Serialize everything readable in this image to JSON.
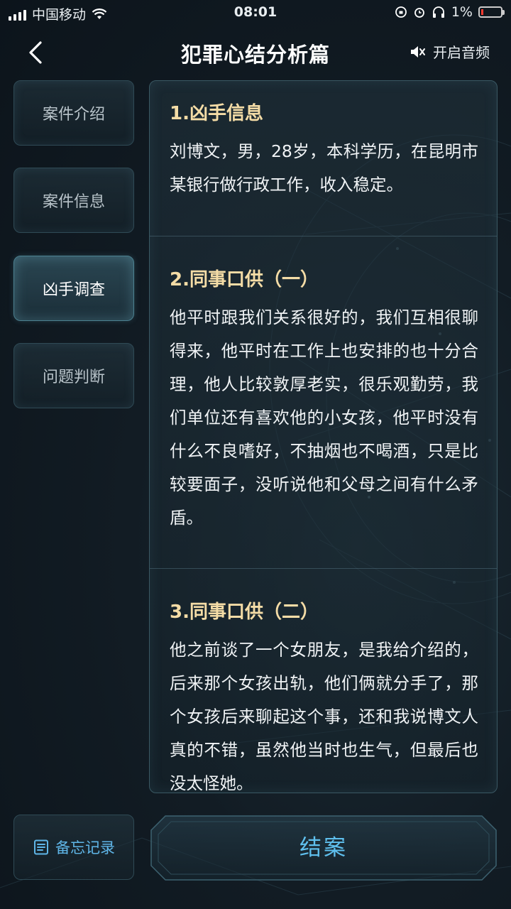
{
  "status_bar": {
    "carrier": "中国移动",
    "time": "08:01",
    "battery": "1%"
  },
  "header": {
    "title": "犯罪心结分析篇",
    "audio_label": "开启音频"
  },
  "sidebar": {
    "items": [
      {
        "label": "案件介绍",
        "active": false
      },
      {
        "label": "案件信息",
        "active": false
      },
      {
        "label": "凶手调查",
        "active": true
      },
      {
        "label": "问题判断",
        "active": false
      }
    ]
  },
  "content": {
    "sections": [
      {
        "title": "1.凶手信息",
        "body": "刘博文，男，28岁，本科学历，在昆明市某银行做行政工作，收入稳定。"
      },
      {
        "title": "2.同事口供（一）",
        "body": "他平时跟我们关系很好的，我们互相很聊得来，他平时在工作上也安排的也十分合理，他人比较敦厚老实，很乐观勤劳，我们单位还有喜欢他的小女孩，他平时没有什么不良嗜好，不抽烟也不喝酒，只是比较要面子，没听说他和父母之间有什么矛盾。"
      },
      {
        "title": "3.同事口供（二）",
        "body": "他之前谈了一个女朋友，是我给介绍的，后来那个女孩出轨，他们俩就分手了，那个女孩后来聊起这个事，还和我说博文人真的不错，虽然他当时也生气，但最后也没太怪她。"
      }
    ]
  },
  "footer": {
    "memo_label": "备忘记录",
    "close_case_label": "结案"
  },
  "colors": {
    "accent_gold": "#f4dca6",
    "accent_blue": "#5fc0ee",
    "battery_low": "#ff3b30"
  }
}
